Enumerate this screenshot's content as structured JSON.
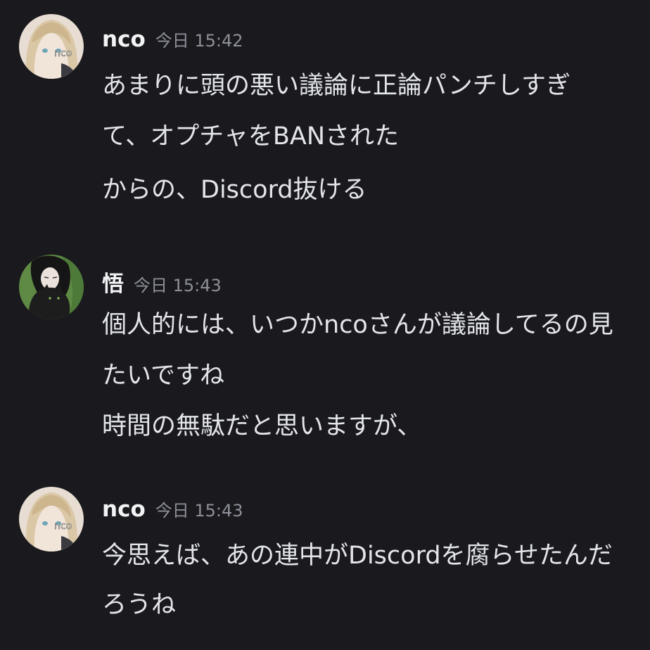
{
  "messages": [
    {
      "username": "nco",
      "timestamp": "今日 15:42",
      "avatar_icon": "anime-girl-blonde-avatar",
      "avatar_text": "nco",
      "lines": [
        "あまりに頭の悪い議論に正論パンチしすぎ",
        "て、オプチャをBANされた",
        "からの、Discord抜ける"
      ]
    },
    {
      "username": "悟",
      "timestamp": "今日 15:43",
      "avatar_icon": "girl-with-black-cat-avatar",
      "lines": [
        "個人的には、いつかncoさんが議論してるの見",
        "たいですね",
        "時間の無駄だと思いますが、"
      ]
    },
    {
      "username": "nco",
      "timestamp": "今日 15:43",
      "avatar_icon": "anime-girl-blonde-avatar",
      "avatar_text": "nco",
      "lines": [
        "今思えば、あの連中がDiscordを腐らせたんだ",
        "ろうね"
      ]
    }
  ],
  "colors": {
    "background": "#1a1a1e",
    "username": "#f2f3f5",
    "timestamp": "#8e9099",
    "text": "#e3e5e8"
  }
}
